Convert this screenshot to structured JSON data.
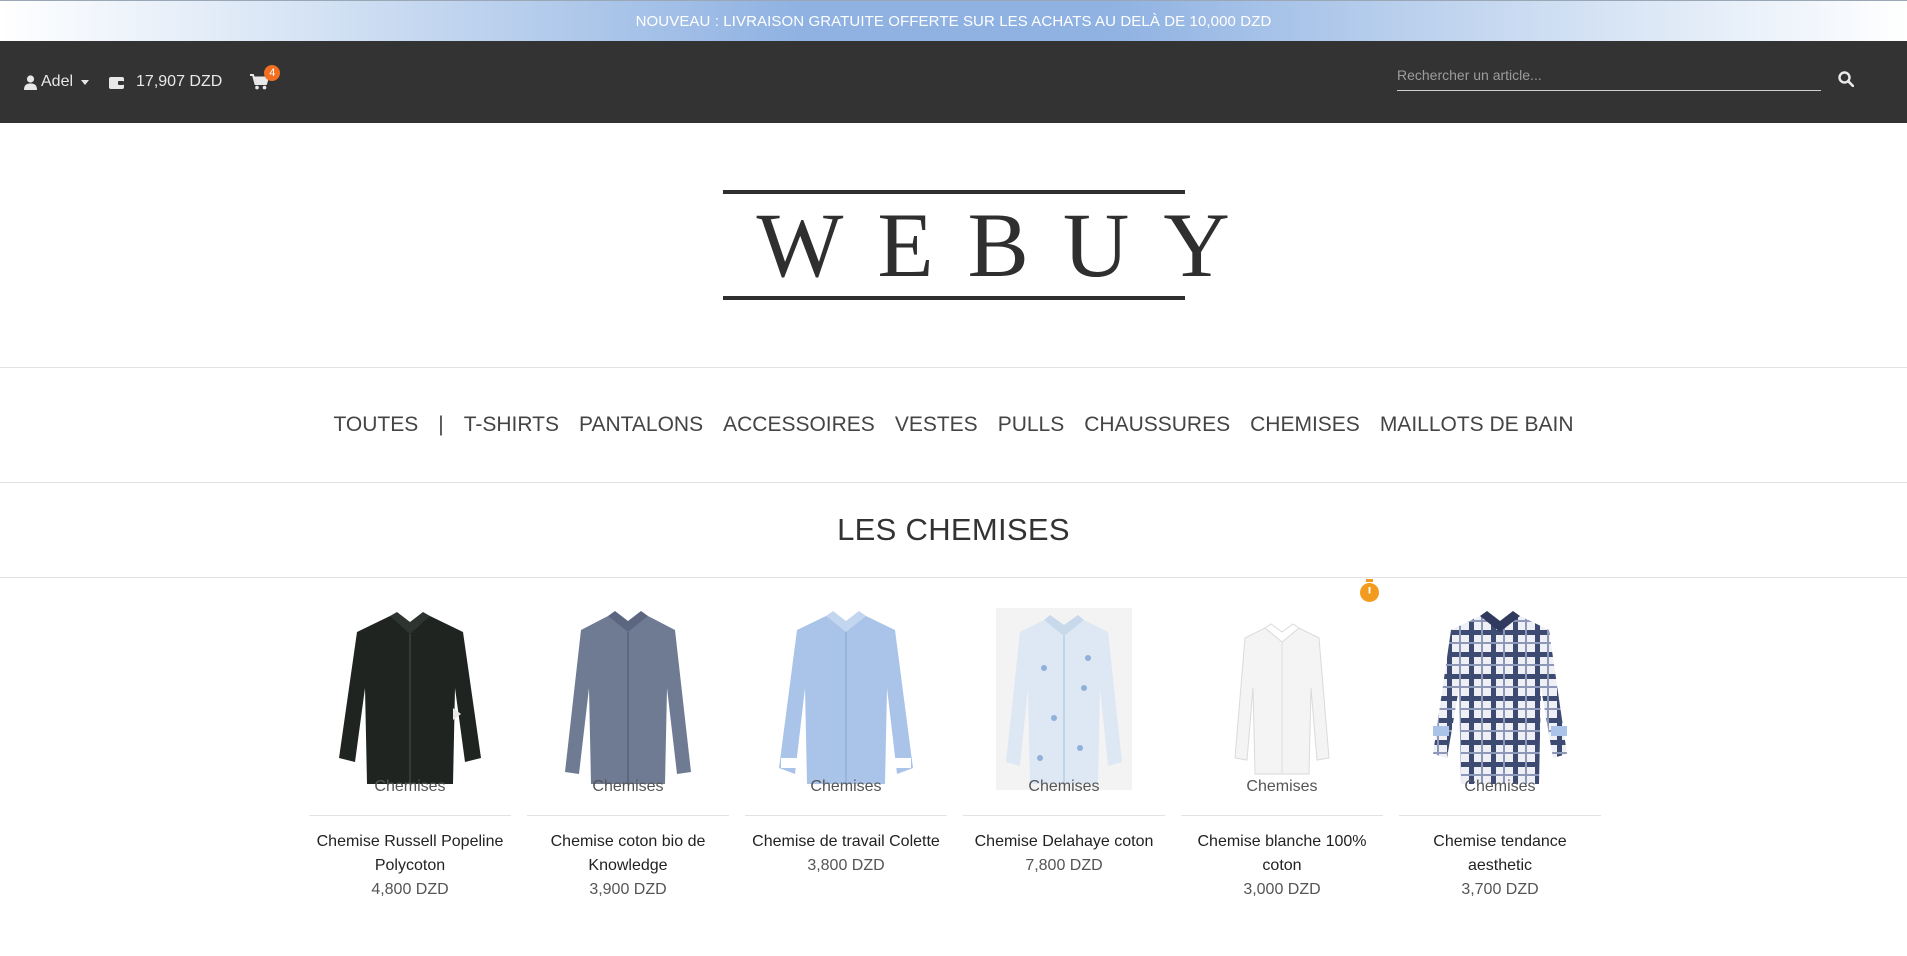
{
  "promo": {
    "text": "NOUVEAU : LIVRAISON GRATUITE OFFERTE SUR LES ACHATS AU DELÀ DE 10,000 DZD"
  },
  "topbar": {
    "user": "Adel",
    "wallet": "17,907 DZD",
    "cart_count": "4",
    "search_placeholder": "Rechercher un article..."
  },
  "logo": {
    "text": "WEBUY"
  },
  "nav": {
    "all": "TOUTES",
    "separator": "|",
    "items": [
      "T-SHIRTS",
      "PANTALONS",
      "ACCESSOIRES",
      "VESTES",
      "PULLS",
      "CHAUSSURES",
      "CHEMISES",
      "MAILLOTS DE BAIN"
    ]
  },
  "section": {
    "title": "LES CHEMISES"
  },
  "products": [
    {
      "category": "Chemises",
      "name": "Chemise Russell Popeline Polycoton",
      "price": "4,800 DZD",
      "shirt_color": "#1f2421"
    },
    {
      "category": "Chemises",
      "name": "Chemise coton bio de Knowledge",
      "price": "3,900 DZD",
      "shirt_color": "#6f7a93"
    },
    {
      "category": "Chemises",
      "name": "Chemise de travail Colette",
      "price": "3,800 DZD",
      "shirt_color": "#a9c4e8"
    },
    {
      "category": "Chemises",
      "name": "Chemise Delahaye coton",
      "price": "7,800 DZD",
      "shirt_color": "#dde8f4"
    },
    {
      "category": "Chemises",
      "name": "Chemise blanche 100% coton",
      "price": "3,000 DZD",
      "shirt_color": "#f4f4f4",
      "badge": "timer-icon"
    },
    {
      "category": "Chemises",
      "name": "Chemise tendance aesthetic",
      "price": "3,700 DZD",
      "shirt_color": "#eef0f6",
      "pattern": "check"
    }
  ],
  "colors": {
    "topbar": "#333333",
    "accent": "#f26f21",
    "promo": "#8fb2e2"
  }
}
